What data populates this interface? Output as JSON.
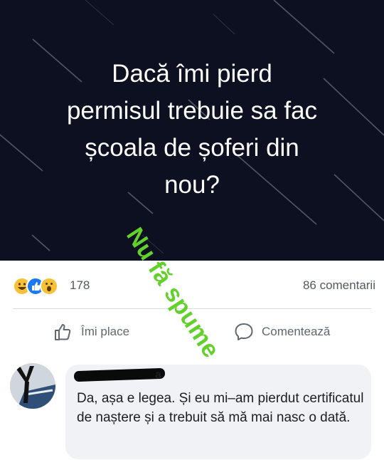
{
  "post": {
    "text_lines": [
      "Dacă îmi pierd",
      "permisul trebuie sa fac",
      "școala de șoferi din",
      "nou?"
    ]
  },
  "watermark": {
    "text": "Nu fă spume",
    "color": "#62d12b"
  },
  "reactions": {
    "icons": [
      "haha-icon",
      "like-icon",
      "wow-icon"
    ],
    "count": "178",
    "comments_label": "86 comentarii"
  },
  "actions": {
    "like_label": "Îmi place",
    "comment_label": "Comentează"
  },
  "comment": {
    "author_visible": "a",
    "text": "Da, așa e legea. Și eu mi–am pierdut certificatul de naștere și a trebuit să mă mai nasc o dată."
  },
  "colors": {
    "banner_bg": "#0c1020",
    "bubble_bg": "#f0f2f5",
    "muted_text": "#606770"
  }
}
